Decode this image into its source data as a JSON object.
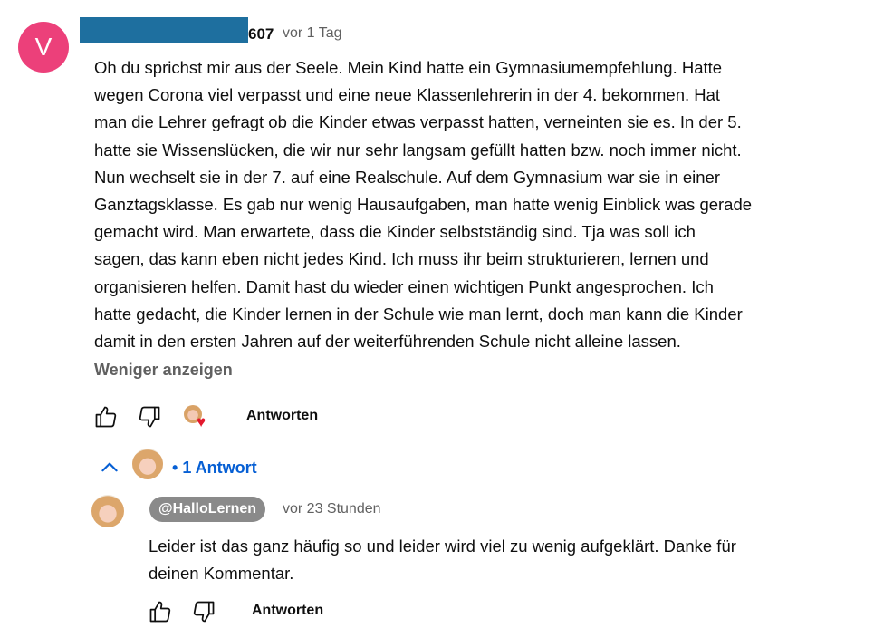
{
  "comment": {
    "avatar_letter": "V",
    "avatar_color": "#ec407a",
    "username_visible_suffix": "607",
    "timestamp": "vor 1 Tag",
    "text": "Oh du sprichst mir aus der Seele. Mein Kind hatte ein Gymnasiumempfehlung. Hatte\nwegen Corona viel verpasst und eine neue Klassenlehrerin in der 4. bekommen. Hat\nman die Lehrer gefragt ob die Kinder etwas verpasst hatten, verneinten sie es. In der 5.\nhatte sie Wissenslücken, die wir nur sehr langsam gefüllt hatten bzw. noch immer nicht.\nNun wechselt sie in der 7.  auf eine Realschule. Auf dem Gymnasium war sie in einer\nGanztagsklasse. Es gab nur wenig Hausaufgaben, man hatte wenig Einblick was gerade\ngemacht wird. Man erwartete, dass die Kinder selbstständig sind. Tja was soll ich\nsagen, das kann eben nicht jedes Kind. Ich muss ihr beim strukturieren, lernen und\norganisieren helfen. Damit hast du wieder einen wichtigen Punkt angesprochen. Ich\nhatte gedacht, die Kinder lernen in der Schule wie man lernt, doch man kann die Kinder\ndamit in den ersten Jahren auf der weiterführenden Schule nicht alleine lassen.",
    "show_less_label": "Weniger anzeigen",
    "reply_label": "Antworten",
    "icons": {
      "like": "thumbs-up-icon",
      "dislike": "thumbs-down-icon",
      "creator_heart": "creator-heart-icon"
    }
  },
  "replies_toggle": {
    "separator": "•",
    "label": "1 Antwort",
    "color": "#065fd4"
  },
  "reply": {
    "handle": "@HalloLernen",
    "timestamp": "vor 23 Stunden",
    "text": "Leider ist das ganz häufig so und leider wird viel zu wenig aufgeklärt. Danke für\ndeinen Kommentar.",
    "reply_label": "Antworten"
  },
  "colors": {
    "redaction": "#1e6f9f",
    "heart": "#e3182d",
    "handle_chip": "#8a8a8a"
  }
}
